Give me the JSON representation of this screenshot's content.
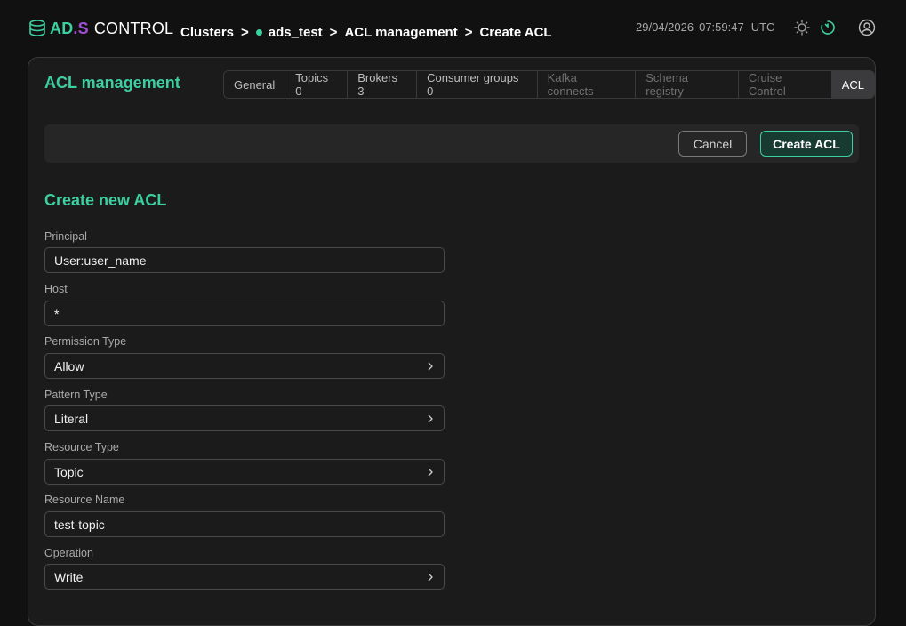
{
  "header": {
    "logo": {
      "ad": "AD",
      "s": ".S",
      "control": "CONTROL"
    },
    "breadcrumb": [
      "Clusters",
      "ads_test",
      "ACL management",
      "Create ACL"
    ],
    "breadcrumb_separator": ">",
    "date": "29/04/2026",
    "time": "07:59:47",
    "timezone": "UTC",
    "icons": [
      "sun-icon",
      "refresh-icon",
      "user-icon"
    ]
  },
  "page": {
    "title": "ACL management",
    "tabs": [
      {
        "label": "General",
        "state": "normal"
      },
      {
        "label": "Topics 0",
        "state": "normal"
      },
      {
        "label": "Brokers 3",
        "state": "normal"
      },
      {
        "label": "Consumer groups 0",
        "state": "normal"
      },
      {
        "label": "Kafka connects",
        "state": "disabled"
      },
      {
        "label": "Schema registry",
        "state": "disabled"
      },
      {
        "label": "Cruise Control",
        "state": "disabled"
      },
      {
        "label": "ACL",
        "state": "active"
      }
    ],
    "actions": {
      "cancel": "Cancel",
      "create": "Create ACL"
    }
  },
  "form": {
    "title": "Create new ACL",
    "fields": [
      {
        "label": "Principal",
        "value": "User:user_name",
        "type": "input"
      },
      {
        "label": "Host",
        "value": "*",
        "type": "input"
      },
      {
        "label": "Permission Type",
        "value": "Allow",
        "type": "select"
      },
      {
        "label": "Pattern Type",
        "value": "Literal",
        "type": "select"
      },
      {
        "label": "Resource Type",
        "value": "Topic",
        "type": "select"
      },
      {
        "label": "Resource Name",
        "value": "test-topic",
        "type": "input"
      },
      {
        "label": "Operation",
        "value": "Write",
        "type": "select"
      }
    ]
  },
  "colors": {
    "accent": "#3ccfa0",
    "brand_purple": "#a34dd6",
    "background": "#111111",
    "panel": "#1b1b1b"
  }
}
